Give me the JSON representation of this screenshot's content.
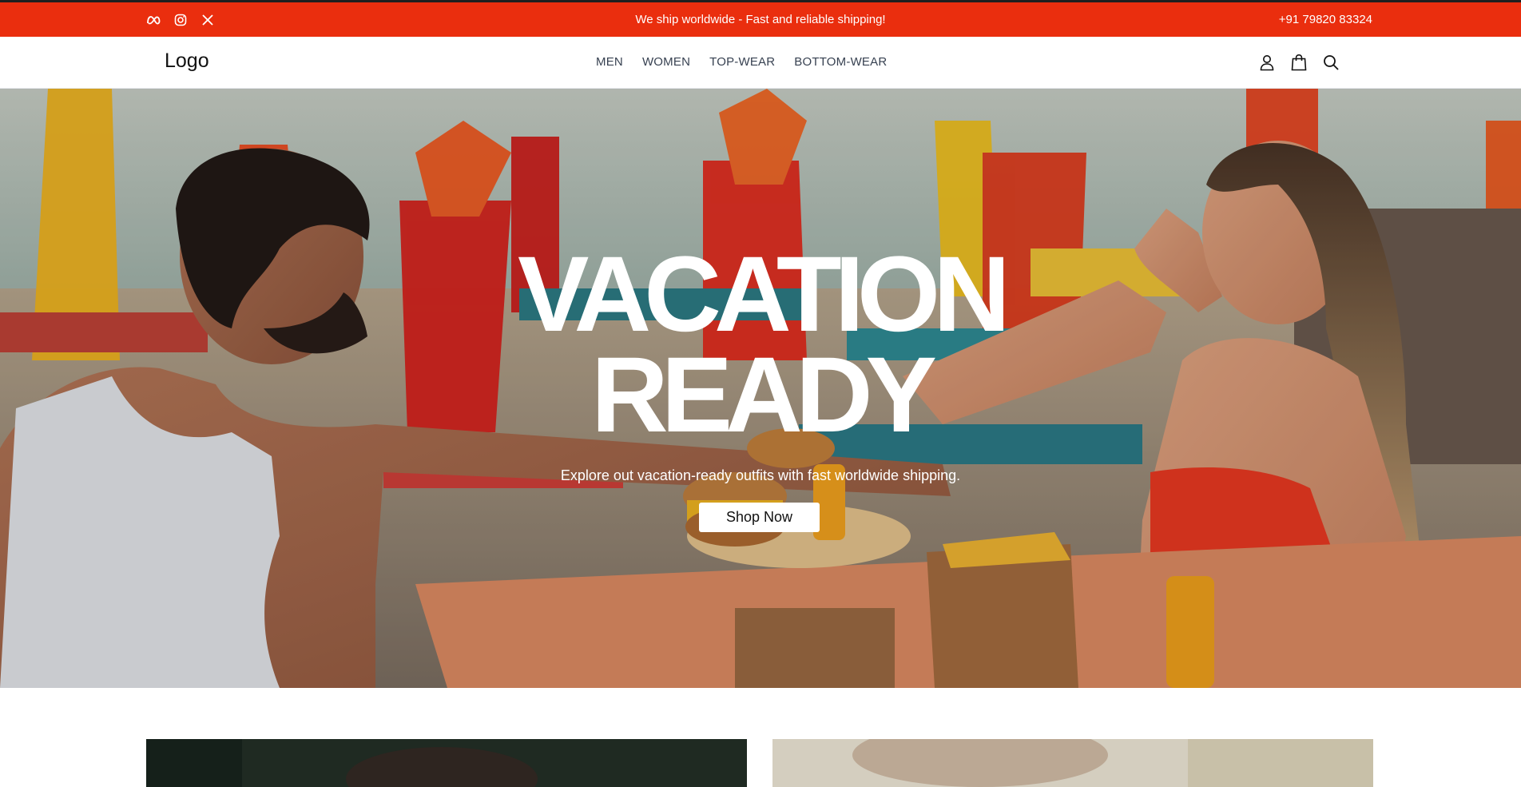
{
  "topbar": {
    "social_icons": [
      "meta-icon",
      "instagram-icon",
      "x-icon"
    ],
    "announcement": "We ship worldwide - Fast and reliable shipping!",
    "phone": "+91 79820 83324",
    "background": "#ea2e0e"
  },
  "navbar": {
    "logo": "Logo",
    "links": [
      "MEN",
      "WOMEN",
      "TOP-WEAR",
      "BOTTOM-WEAR"
    ],
    "icons": [
      "user-icon",
      "shopping-bag-icon",
      "search-icon"
    ]
  },
  "hero": {
    "title_line1": "VACATION",
    "title_line2": "READY",
    "subtitle": "Explore out vacation-ready outfits with fast worldwide shipping.",
    "cta_label": "Shop Now"
  },
  "collections": {
    "cards": [
      "men-collection-image",
      "women-collection-image"
    ]
  }
}
